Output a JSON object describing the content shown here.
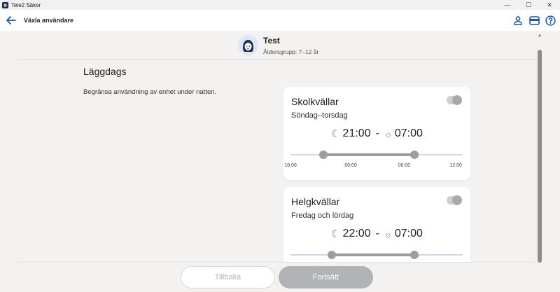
{
  "window": {
    "title": "Tele2 Säker",
    "controls": {
      "minimize": "—",
      "maximize": "☐",
      "close": "✕"
    }
  },
  "header": {
    "title": "Växla användare",
    "icons": [
      "back-arrow-icon",
      "user-icon",
      "wallet-icon",
      "help-icon"
    ]
  },
  "profile": {
    "name": "Test",
    "age_group": "Åldersgrupp: 7–12 år"
  },
  "section": {
    "title": "Läggdags",
    "description": "Begränsa användning av enhet under natten."
  },
  "cards": [
    {
      "title": "Skolkvällar",
      "subtitle": "Söndag–torsdag",
      "enabled": true,
      "start": "21:00",
      "end": "07:00",
      "start_fraction": 0.19,
      "end_fraction": 0.72
    },
    {
      "title": "Helgkvällar",
      "subtitle": "Fredag och lördag",
      "enabled": true,
      "start": "22:00",
      "end": "07:00",
      "start_fraction": 0.24,
      "end_fraction": 0.72
    }
  ],
  "slider_ticks": [
    "18:00",
    "00:00",
    "06:00",
    "12:00"
  ],
  "separator": "-",
  "footer": {
    "back_label": "Tillbaka",
    "next_label": "Fortsätt"
  },
  "colors": {
    "accent": "#1a56a8",
    "track": "#cfd9ea",
    "range": "#9c9c9c",
    "disabled_button": "#b1b3b6"
  }
}
